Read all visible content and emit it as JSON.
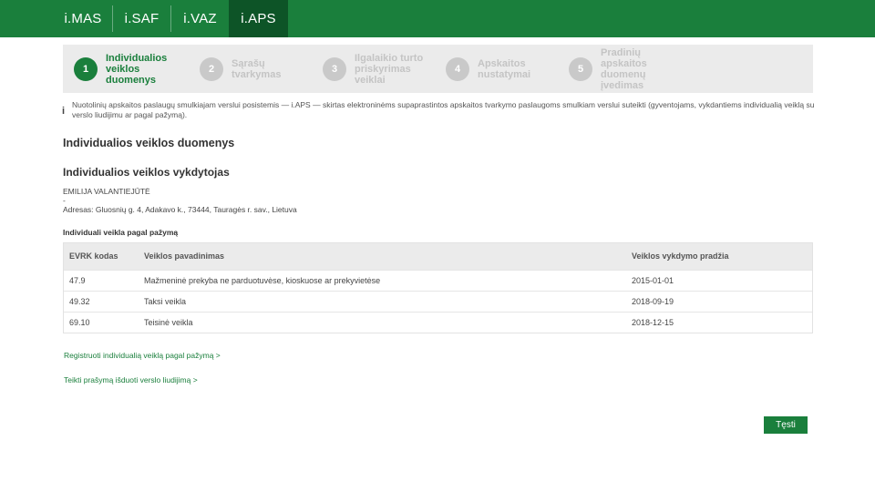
{
  "topnav": {
    "tabs": [
      {
        "label": "i.MAS"
      },
      {
        "label": "i.SAF"
      },
      {
        "label": "i.VAZ"
      },
      {
        "label": "i.APS"
      }
    ],
    "active": "i.APS"
  },
  "steps": [
    {
      "num": "1",
      "label": "Individualios veiklos duomenys"
    },
    {
      "num": "2",
      "label": "Sąrašų tvarkymas"
    },
    {
      "num": "3",
      "label": "Ilgalaikio turto priskyrimas veiklai"
    },
    {
      "num": "4",
      "label": "Apskaitos nustatymai"
    },
    {
      "num": "5",
      "label": "Pradinių apskaitos duomenų įvedimas"
    }
  ],
  "notice": {
    "icon": "i",
    "text": "Nuotolinių apskaitos paslaugų smulkiajam verslui posistemis — i.APS — skirtas elektroninėms supaprastintos apskaitos tvarkymo paslaugoms smulkiam verslui suteikti (gyventojams, vykdantiems individualią veiklą su verslo liudijimu ar pagal pažymą)."
  },
  "page_title": "Individualios veiklos duomenys",
  "section_title": "Individualios veiklos vykdytojas",
  "person": {
    "name": "EMILIJA VALANTIEJŪTĖ",
    "dash": "-",
    "address": "Adresas: Gluosnių g. 4, Adakavo k., 73444, Tauragės r. sav., Lietuva"
  },
  "table_title": "Individuali veikla pagal pažymą",
  "table": {
    "headers": [
      "EVRK kodas",
      "Veiklos pavadinimas",
      "Veiklos vykdymo pradžia"
    ],
    "rows": [
      [
        "47.9",
        "Mažmeninė prekyba ne parduotuvėse, kioskuose ar prekyvietėse",
        "2015-01-01"
      ],
      [
        "49.32",
        "Taksi veikla",
        "2018-09-19"
      ],
      [
        "69.10",
        "Teisinė veikla",
        "2018-12-15"
      ]
    ]
  },
  "links": {
    "register": "Registruoti individualią veiklą pagal pažymą  >",
    "request": "Teikti prašymą išduoti verslo liudijimą  >"
  },
  "buttons": {
    "continue": "Tęsti"
  },
  "colors": {
    "brand_green": "#1a7f3c",
    "active_tab": "#0d5427",
    "inactive_step": "#c9c9c9"
  }
}
